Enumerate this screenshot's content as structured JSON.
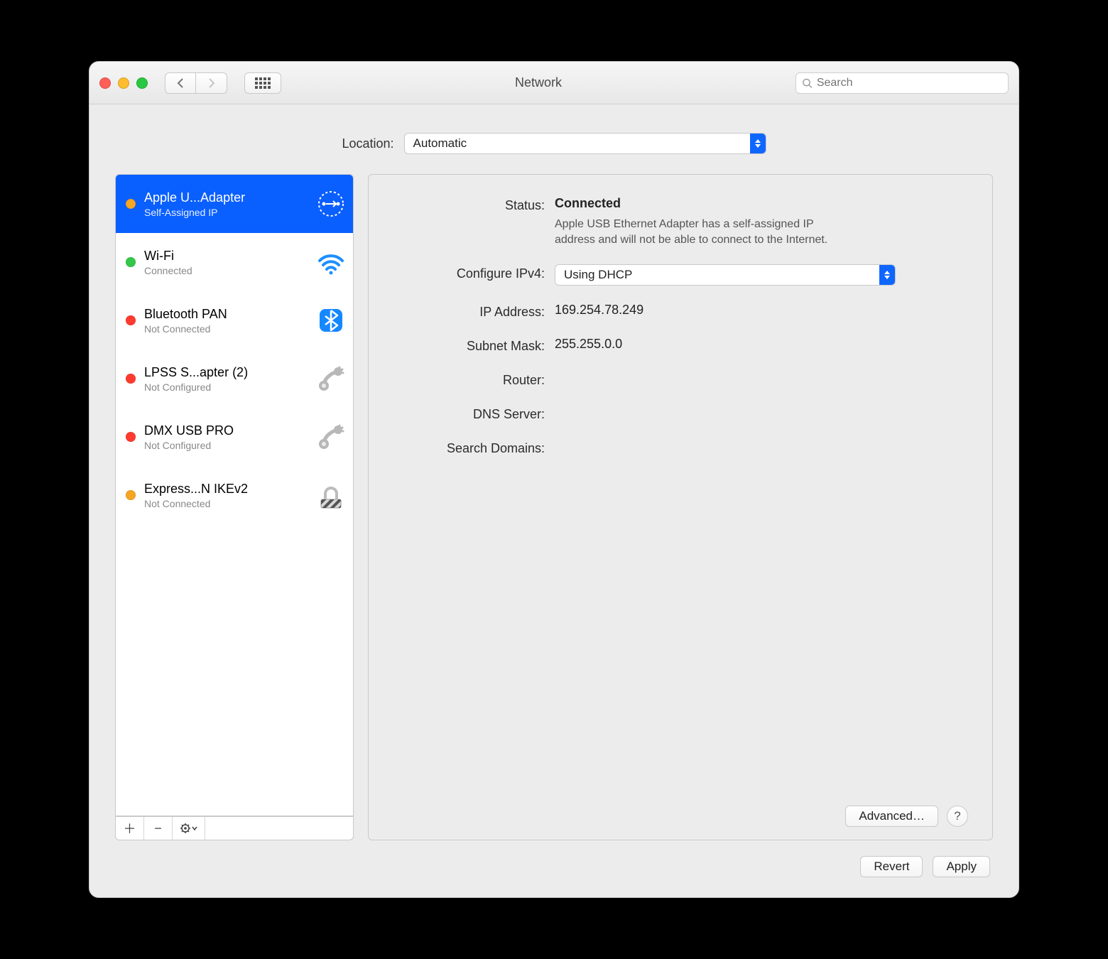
{
  "window": {
    "title": "Network"
  },
  "search": {
    "placeholder": "Search"
  },
  "location": {
    "label": "Location:",
    "value": "Automatic"
  },
  "sidebar": {
    "items": [
      {
        "name": "Apple U...Adapter",
        "sub": "Self-Assigned IP",
        "dot": "orange",
        "icon": "ethernet",
        "selected": true
      },
      {
        "name": "Wi-Fi",
        "sub": "Connected",
        "dot": "green",
        "icon": "wifi"
      },
      {
        "name": "Bluetooth PAN",
        "sub": "Not Connected",
        "dot": "red",
        "icon": "bluetooth"
      },
      {
        "name": "LPSS S...apter (2)",
        "sub": "Not Configured",
        "dot": "red",
        "icon": "serial"
      },
      {
        "name": "DMX USB PRO",
        "sub": "Not Configured",
        "dot": "red",
        "icon": "serial"
      },
      {
        "name": "Express...N IKEv2",
        "sub": "Not Connected",
        "dot": "orange",
        "icon": "vpn"
      }
    ]
  },
  "detail": {
    "status_label": "Status:",
    "status_value": "Connected",
    "status_desc": "Apple USB Ethernet Adapter has a self-assigned IP address and will not be able to connect to the Internet.",
    "configure_label": "Configure IPv4:",
    "configure_value": "Using DHCP",
    "ip_label": "IP Address:",
    "ip_value": "169.254.78.249",
    "mask_label": "Subnet Mask:",
    "mask_value": "255.255.0.0",
    "router_label": "Router:",
    "router_value": "",
    "dns_label": "DNS Server:",
    "dns_value": "",
    "domains_label": "Search Domains:",
    "domains_value": "",
    "advanced": "Advanced…"
  },
  "footer": {
    "revert": "Revert",
    "apply": "Apply"
  },
  "help": "?"
}
